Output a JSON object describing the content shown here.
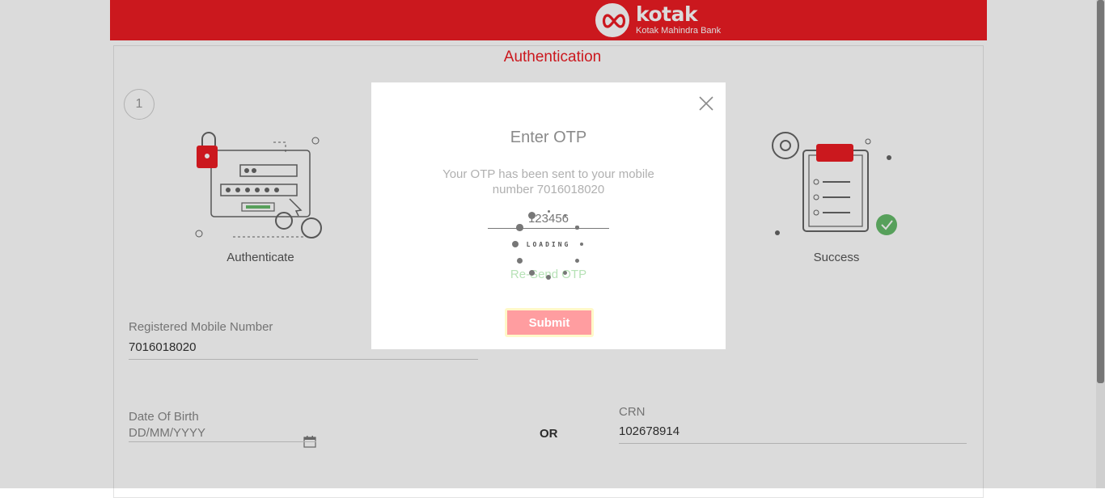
{
  "brand": {
    "name": "kotak",
    "subtitle": "Kotak Mahindra Bank",
    "color": "#ed1c24"
  },
  "page": {
    "title": "Authentication"
  },
  "steps": [
    {
      "number": "1",
      "label": "Authenticate"
    },
    {
      "label": "Success"
    }
  ],
  "form": {
    "mobile": {
      "label": "Registered Mobile Number",
      "value": "7016018020"
    },
    "dob": {
      "label": "Date Of Birth",
      "placeholder": "DD/MM/YYYY"
    },
    "or_text": "OR",
    "crn": {
      "label": "CRN",
      "value": "102678914"
    }
  },
  "modal": {
    "title": "Enter OTP",
    "message": "Your OTP has been sent to your mobile number 7016018020",
    "otp_placeholder": "123456",
    "resend_label": "Re-Send OTP",
    "submit_label": "Submit",
    "loading_text": "LOADING"
  }
}
